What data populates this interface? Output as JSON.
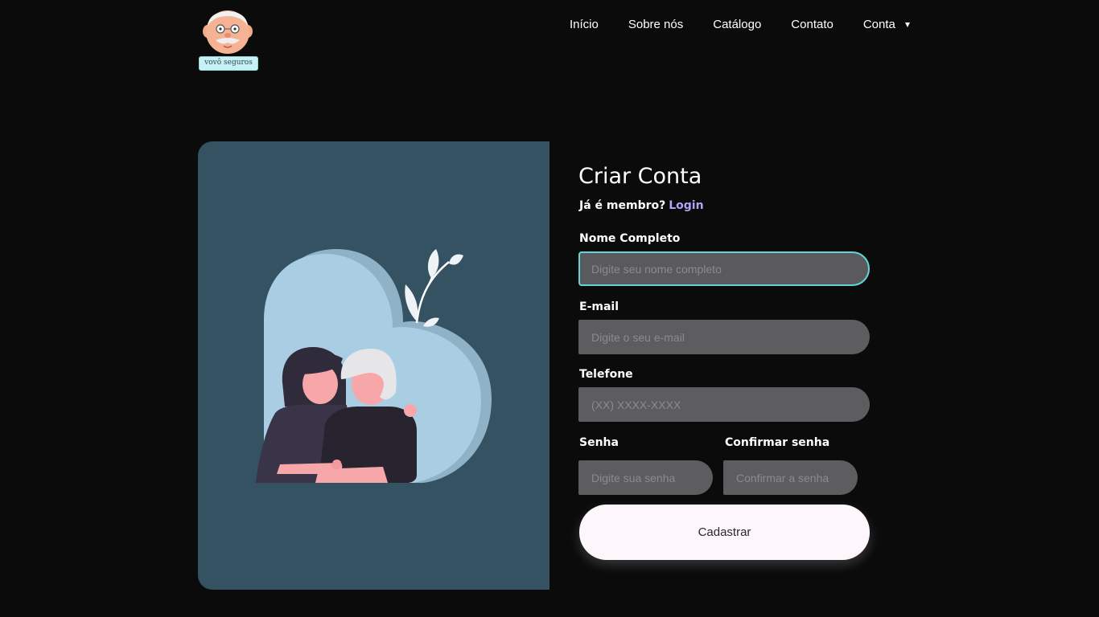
{
  "brand": {
    "logo_text": "vovô seguros"
  },
  "nav": {
    "items": [
      {
        "label": "Início"
      },
      {
        "label": "Sobre nós"
      },
      {
        "label": "Catálogo"
      },
      {
        "label": "Contato"
      },
      {
        "label": "Conta"
      }
    ]
  },
  "form": {
    "title": "Criar Conta",
    "member_prompt": "Já é membro?",
    "login_link": "Login",
    "fields": {
      "name": {
        "label": "Nome Completo",
        "placeholder": "Digite seu nome completo"
      },
      "email": {
        "label": "E-mail",
        "placeholder": "Digite o seu e-mail"
      },
      "phone": {
        "label": "Telefone",
        "placeholder": "(XX) XXXX-XXXX"
      },
      "password": {
        "label": "Senha",
        "placeholder": "Digite sua senha"
      },
      "confirm": {
        "label": "Confirmar senha",
        "placeholder": "Confirmar a senha"
      }
    },
    "submit_label": "Cadastrar"
  },
  "colors": {
    "page_bg": "#0b0b0c",
    "panel_bg": "#345261",
    "input_bg": "#5d5d5f",
    "focus_border": "#5fd6dd",
    "link": "#b6a2f7",
    "button_bg": "#fdf6fb"
  },
  "icons": [
    "grandpa-logo-icon",
    "dropdown-caret-icon",
    "couple-heart-illustration"
  ]
}
